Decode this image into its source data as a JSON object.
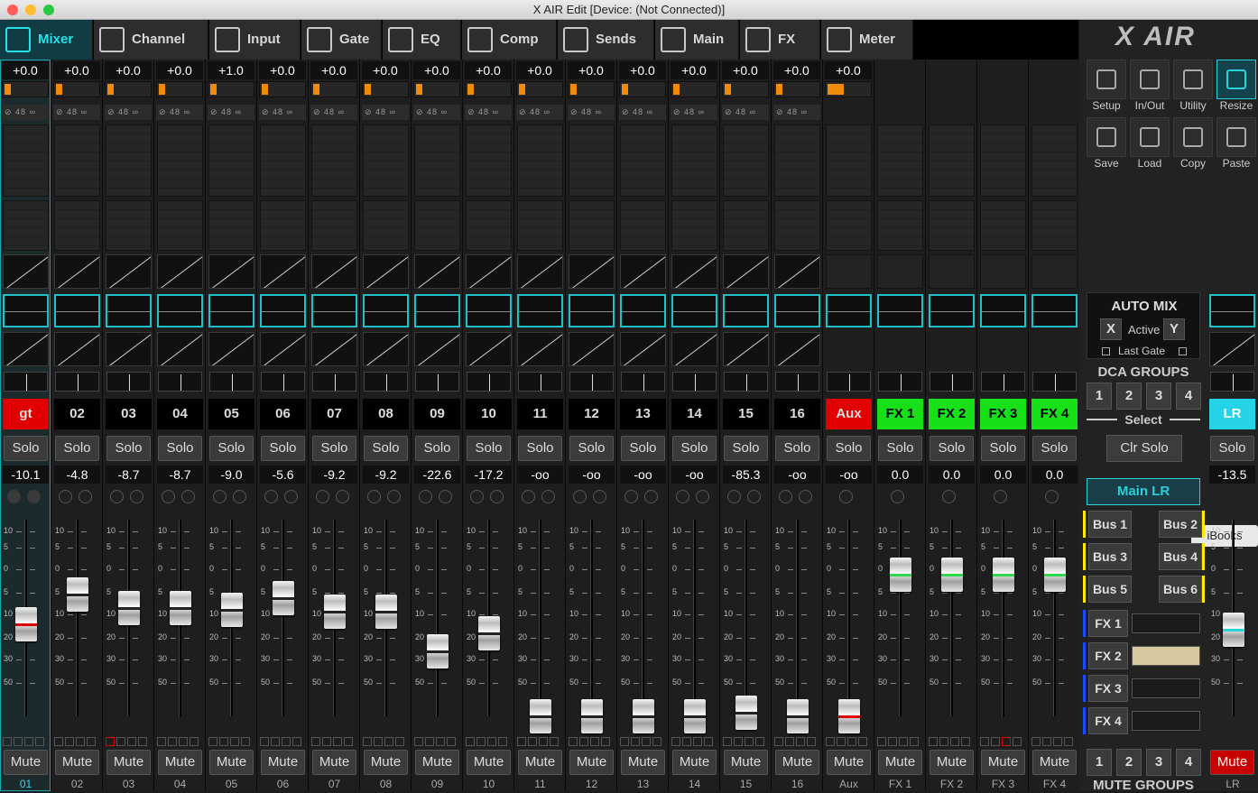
{
  "window": {
    "title": "X AIR Edit [Device: (Not Connected)]"
  },
  "tabs": [
    "Mixer",
    "Channel",
    "Input",
    "Gate",
    "EQ",
    "Comp",
    "Sends",
    "Main",
    "FX",
    "Meter"
  ],
  "channels": [
    {
      "name": "gt",
      "gain": "+0.0",
      "fader_value": "-10.1",
      "footer": "01",
      "color": "#e00000",
      "fader_level": 0.47
    },
    {
      "name": "02",
      "gain": "+0.0",
      "fader_value": "-4.8",
      "footer": "02",
      "color": "#000000",
      "fader_level": 0.62
    },
    {
      "name": "03",
      "gain": "+0.0",
      "fader_value": "-8.7",
      "footer": "03",
      "color": "#000000",
      "fader_level": 0.55
    },
    {
      "name": "04",
      "gain": "+0.0",
      "fader_value": "-8.7",
      "footer": "04",
      "color": "#000000",
      "fader_level": 0.55
    },
    {
      "name": "05",
      "gain": "+1.0",
      "fader_value": "-9.0",
      "footer": "05",
      "color": "#000000",
      "fader_level": 0.54
    },
    {
      "name": "06",
      "gain": "+0.0",
      "fader_value": "-5.6",
      "footer": "06",
      "color": "#000000",
      "fader_level": 0.6
    },
    {
      "name": "07",
      "gain": "+0.0",
      "fader_value": "-9.2",
      "footer": "07",
      "color": "#000000",
      "fader_level": 0.53
    },
    {
      "name": "08",
      "gain": "+0.0",
      "fader_value": "-9.2",
      "footer": "08",
      "color": "#000000",
      "fader_level": 0.53
    },
    {
      "name": "09",
      "gain": "+0.0",
      "fader_value": "-22.6",
      "footer": "09",
      "color": "#000000",
      "fader_level": 0.33
    },
    {
      "name": "10",
      "gain": "+0.0",
      "fader_value": "-17.2",
      "footer": "10",
      "color": "#000000",
      "fader_level": 0.42
    },
    {
      "name": "11",
      "gain": "+0.0",
      "fader_value": "-oo",
      "footer": "11",
      "color": "#000000",
      "fader_level": 0.0
    },
    {
      "name": "12",
      "gain": "+0.0",
      "fader_value": "-oo",
      "footer": "12",
      "color": "#000000",
      "fader_level": 0.0
    },
    {
      "name": "13",
      "gain": "+0.0",
      "fader_value": "-oo",
      "footer": "13",
      "color": "#000000",
      "fader_level": 0.0
    },
    {
      "name": "14",
      "gain": "+0.0",
      "fader_value": "-oo",
      "footer": "14",
      "color": "#000000",
      "fader_level": 0.0
    },
    {
      "name": "15",
      "gain": "+0.0",
      "fader_value": "-85.3",
      "footer": "15",
      "color": "#000000",
      "fader_level": 0.02
    },
    {
      "name": "16",
      "gain": "+0.0",
      "fader_value": "-oo",
      "footer": "16",
      "color": "#000000",
      "fader_level": 0.0
    },
    {
      "name": "Aux",
      "gain": "+0.0",
      "fader_value": "-oo",
      "footer": "Aux",
      "color": "#e00000",
      "fader_level": 0.0
    },
    {
      "name": "FX 1",
      "gain": "",
      "fader_value": "0.0",
      "footer": "FX 1",
      "color": "#18e018",
      "fader_level": 0.72
    },
    {
      "name": "FX 2",
      "gain": "",
      "fader_value": "0.0",
      "footer": "FX 2",
      "color": "#18e018",
      "fader_level": 0.72
    },
    {
      "name": "FX 3",
      "gain": "",
      "fader_value": "0.0",
      "footer": "FX 3",
      "color": "#18e018",
      "fader_level": 0.72
    },
    {
      "name": "FX 4",
      "gain": "",
      "fader_value": "0.0",
      "footer": "FX 4",
      "color": "#18e018",
      "fader_level": 0.72
    }
  ],
  "labels": {
    "solo": "Solo",
    "mute": "Mute",
    "phantom": "48"
  },
  "scale": [
    "10",
    "5",
    "0",
    "5",
    "10",
    "20",
    "30",
    "50"
  ],
  "logo": "X AIR",
  "tools": [
    "Setup",
    "In/Out",
    "Utility",
    "Resize",
    "Save",
    "Load",
    "Copy",
    "Paste"
  ],
  "automix": {
    "title": "AUTO MIX",
    "x": "X",
    "active": "Active",
    "y": "Y",
    "last_gate": "Last Gate"
  },
  "dca": {
    "title": "DCA GROUPS",
    "buttons": [
      "1",
      "2",
      "3",
      "4"
    ],
    "select": "Select",
    "clr_solo": "Clr Solo"
  },
  "main_lr": "Main LR",
  "buses": [
    "Bus 1",
    "Bus 2",
    "Bus 3",
    "Bus 4",
    "Bus 5",
    "Bus 6"
  ],
  "fx_slots": [
    "FX 1",
    "FX 2",
    "FX 3",
    "FX 4"
  ],
  "tooltip": "iBooks",
  "mute_groups": {
    "title": "MUTE GROUPS",
    "buttons": [
      "1",
      "2",
      "3",
      "4"
    ]
  },
  "lr": {
    "name": "LR",
    "solo": "Solo",
    "fader_value": "-13.5",
    "mute": "Mute",
    "footer": "LR",
    "fader_level": 0.44
  }
}
